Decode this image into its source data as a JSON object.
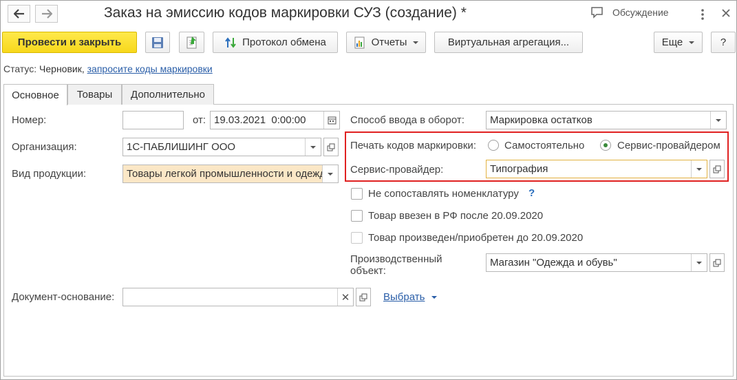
{
  "window": {
    "title": "Заказ на эмиссию кодов маркировки СУЗ (создание) *",
    "discussion_label": "Обсуждение"
  },
  "toolbar": {
    "post_close_label": "Провести и закрыть",
    "exchange_log_label": "Протокол обмена",
    "reports_label": "Отчеты",
    "virtual_aggregation_label": "Виртуальная агрегация...",
    "more_label": "Еще",
    "help_label": "?"
  },
  "status": {
    "prefix": "Статус:",
    "value": "Черновик,",
    "link": "запросите коды маркировки"
  },
  "tabs": [
    {
      "label": "Основное"
    },
    {
      "label": "Товары"
    },
    {
      "label": "Дополнительно"
    }
  ],
  "form": {
    "number_label": "Номер:",
    "number_value": "",
    "date_label": "от:",
    "date_value": "19.03.2021  0:00:00",
    "organization_label": "Организация:",
    "organization_value": "1С-ПАБЛИШИНГ ООО",
    "product_type_label": "Вид продукции:",
    "product_type_value": "Товары легкой промышленности и одежда",
    "entry_method_label": "Способ ввода в оборот:",
    "entry_method_value": "Маркировка остатков",
    "print_codes_label": "Печать кодов маркировки:",
    "print_option_self": "Самостоятельно",
    "print_option_provider": "Сервис-провайдером",
    "service_provider_label": "Сервис-провайдер:",
    "service_provider_value": "Типография",
    "no_match_label": "Не сопоставлять номенклатуру",
    "no_match_help": "?",
    "imported_label": "Товар ввезен в РФ после 20.09.2020",
    "produced_label": "Товар произведен/приобретен до 20.09.2020",
    "production_object_label_1": "Производственный",
    "production_object_label_2": "объект:",
    "production_object_value": "Магазин \"Одежда и обувь\"",
    "base_doc_label": "Документ-основание:",
    "base_doc_value": "",
    "select_label": "Выбрать"
  },
  "colors": {
    "primary_button": "#f7d81c",
    "highlight_field": "#fbe7c6",
    "link": "#2a5ea8",
    "annotation_box": "#e02020"
  }
}
